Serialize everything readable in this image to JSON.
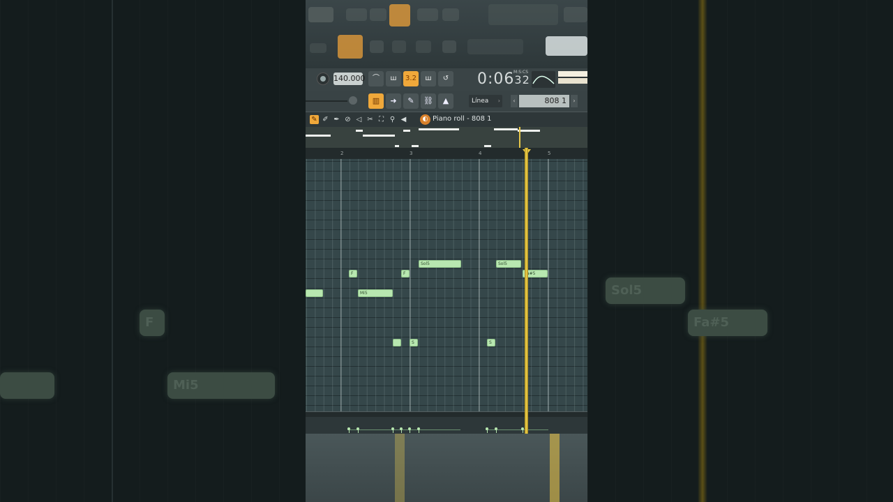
{
  "transport": {
    "tempo": "140.000",
    "pattern_label": "3.2",
    "time_main": "0:06",
    "time_sub": "32",
    "time_unit": "M:S:CS"
  },
  "toolbar": {
    "snap_value": "Línea",
    "channel_name": "808 1"
  },
  "piano_roll": {
    "title": "Piano roll - 808 1",
    "ruler": [
      "2",
      "3",
      "4",
      "5"
    ],
    "notes": [
      {
        "label": "Sol5"
      },
      {
        "label": "Sol5"
      },
      {
        "label": "Fa#5"
      },
      {
        "label": "F"
      },
      {
        "label": "F"
      },
      {
        "label": "Mi5"
      },
      {
        "label": ""
      },
      {
        "label": ""
      },
      {
        "label": "S"
      },
      {
        "label": "S"
      }
    ]
  },
  "side_ghosts": {
    "left_f": "F",
    "left_mi": "Mi5",
    "right_sol": "Sol5",
    "right_fa": "Fa#5"
  },
  "colors": {
    "accent": "#f0a83a",
    "note": "#b8e7b0",
    "playhead": "#f4d34c",
    "grid": "#35474a"
  }
}
